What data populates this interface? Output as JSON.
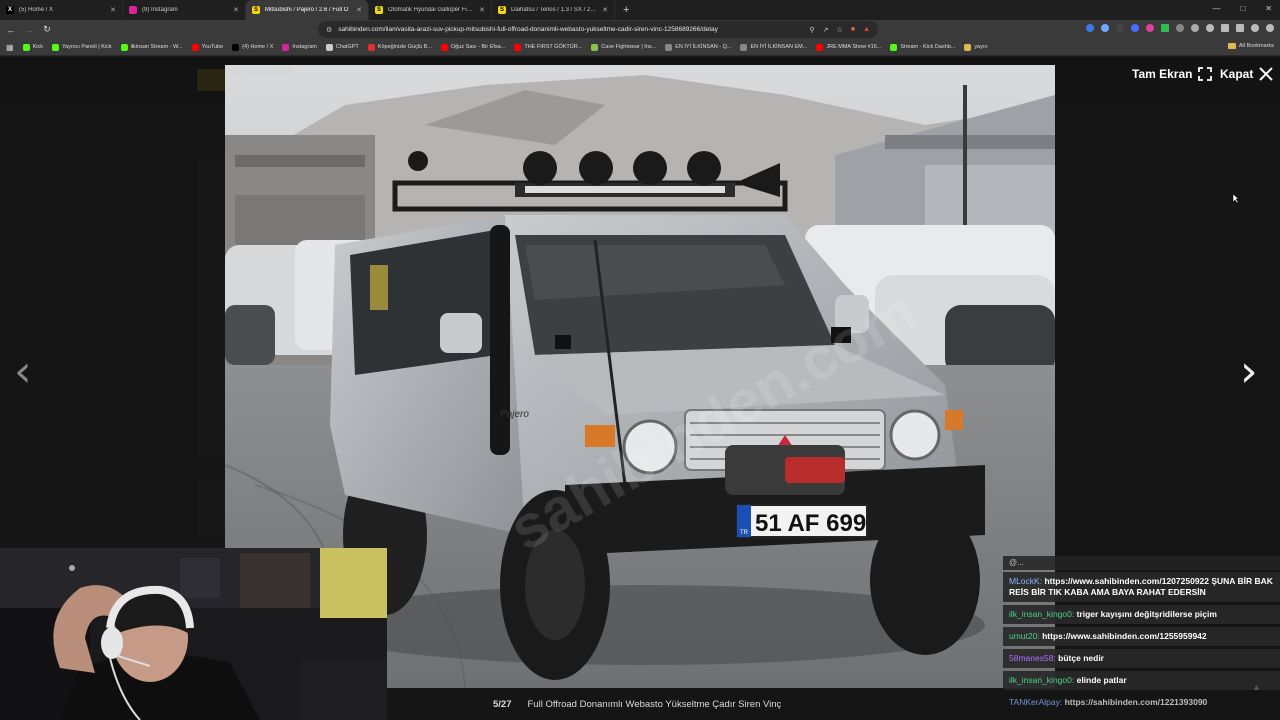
{
  "browser": {
    "tabs": [
      {
        "label": "(5) Home / X",
        "color": "#000000",
        "glyph": "X",
        "active": false
      },
      {
        "label": "(9) Instagram",
        "color": "#d6249f",
        "glyph": "",
        "active": false
      },
      {
        "label": "Mitsubishi / Pajero / 2.6 / Full O",
        "color": "#f5d90a",
        "glyph": "S",
        "active": true
      },
      {
        "label": "Otomatik Hyundai Galloper Fiyatları",
        "color": "#f5d90a",
        "glyph": "S",
        "active": false
      },
      {
        "label": "Daihatsu / Terios / 1.3 / SX / 2004 M",
        "color": "#f5d90a",
        "glyph": "S",
        "active": false
      }
    ],
    "new_tab": "+",
    "url": "sahibinden.com/ilan/vasita-arazi-suv-pickup-mitsubishi-full-offroad-donanimli-webasto-yukseltme-cadir-siren-vinc-1258689266/detay",
    "bookmarks": [
      {
        "label": "Kick",
        "color": "#53fc18"
      },
      {
        "label": "Yayıncı Paneli | Kick",
        "color": "#53fc18"
      },
      {
        "label": "ilkinsan Stream - W...",
        "color": "#53fc18"
      },
      {
        "label": "YouTube",
        "color": "#ff0000"
      },
      {
        "label": "(4) Home / X",
        "color": "#000000"
      },
      {
        "label": "Instagram",
        "color": "#d6249f"
      },
      {
        "label": "ChatGPT",
        "color": "#cccccc"
      },
      {
        "label": "Köpeğinizle Güçlü B...",
        "color": "#e03030"
      },
      {
        "label": "Oğuz Sası - Bir Efsa...",
        "color": "#ff0000"
      },
      {
        "label": "THE FIRST GÖKTÜR...",
        "color": "#ff0000"
      },
      {
        "label": "Cave Fightwear | Ins...",
        "color": "#8bc34a"
      },
      {
        "label": "EN İYİ İLKİNSAN - Q...",
        "color": "#888888"
      },
      {
        "label": "EN İYİ İLKİNSAN EM...",
        "color": "#888888"
      },
      {
        "label": "JRE MMA Show #16...",
        "color": "#ff0000"
      },
      {
        "label": "Stream - Kick Dashb...",
        "color": "#53fc18"
      },
      {
        "label": "yayın",
        "color": "#e0b94a"
      }
    ],
    "all_bookmarks": "All Bookmarks"
  },
  "viewer": {
    "listing_id": "#1258689266",
    "fullscreen_label": "Tam Ekran",
    "close_label": "Kapat",
    "counter": "5/27",
    "caption": "Full Offroad Donanımlı Webasto Yükseltme Çadır Siren Vinç",
    "plate": "51 AF 699",
    "plate_country": "TR",
    "model_badge": "Pajero"
  },
  "chat": {
    "top_partial": "@...",
    "messages": [
      {
        "user": "MLockK:",
        "user_color": "#8ab4ff",
        "text": "https://www.sahibinden.com/1207250922 ŞUNA BİR BAK REİS BİR TIK KABA AMA BAYA RAHAT EDERSİN",
        "boxed": true
      },
      {
        "user": "ilk_insan_kingo0:",
        "user_color": "#4fd18b",
        "text": "triger kayışını değitşridilerse piçim",
        "boxed": true
      },
      {
        "user": "umut20:",
        "user_color": "#4fd18b",
        "text": "https://www.sahibinden.com/1255959942",
        "boxed": true
      },
      {
        "user": "58manes58:",
        "user_color": "#b070ff",
        "text": "bütçe nedir",
        "boxed": true
      },
      {
        "user": "ilk_insan_kingo0:",
        "user_color": "#4fd18b",
        "text": "elinde patlar",
        "boxed": true
      },
      {
        "user": "TANKerAlpay:",
        "user_color": "#8ab4ff",
        "text": "https://sahibinden.com/1221393090",
        "boxed": false
      }
    ]
  }
}
